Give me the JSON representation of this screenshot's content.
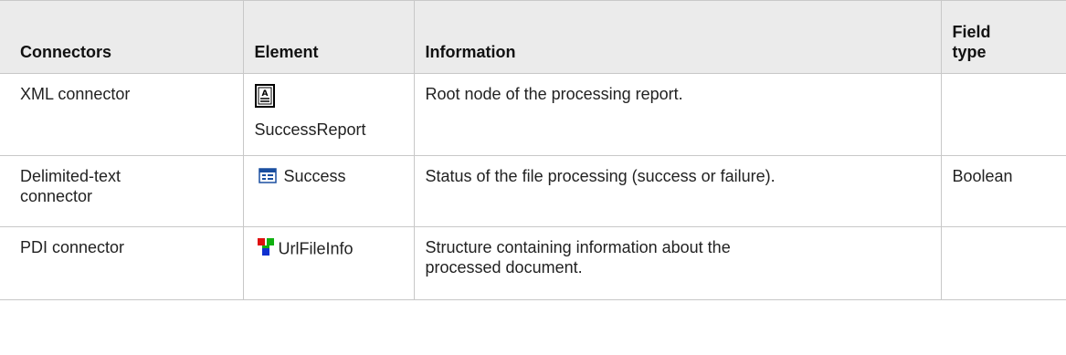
{
  "table": {
    "headers": {
      "connectors": "Connectors",
      "element": "Element",
      "information": "Information",
      "field_type_line1": "Field",
      "field_type_line2": "type"
    },
    "rows": [
      {
        "connector": "XML connector",
        "element": "SuccessReport",
        "element_icon": "document-node-icon",
        "information": "Root node of the processing report.",
        "field_type": ""
      },
      {
        "connector_line1": "Delimited-text",
        "connector_line2": "connector",
        "element": "Success",
        "element_icon": "field-icon",
        "information": "Status of the file processing (success or failure).",
        "field_type": "Boolean"
      },
      {
        "connector": "PDI connector",
        "element": "UrlFileInfo",
        "element_icon": "structure-icon",
        "information_line1": "Structure containing information about the",
        "information_line2": "processed document.",
        "field_type": ""
      }
    ]
  }
}
